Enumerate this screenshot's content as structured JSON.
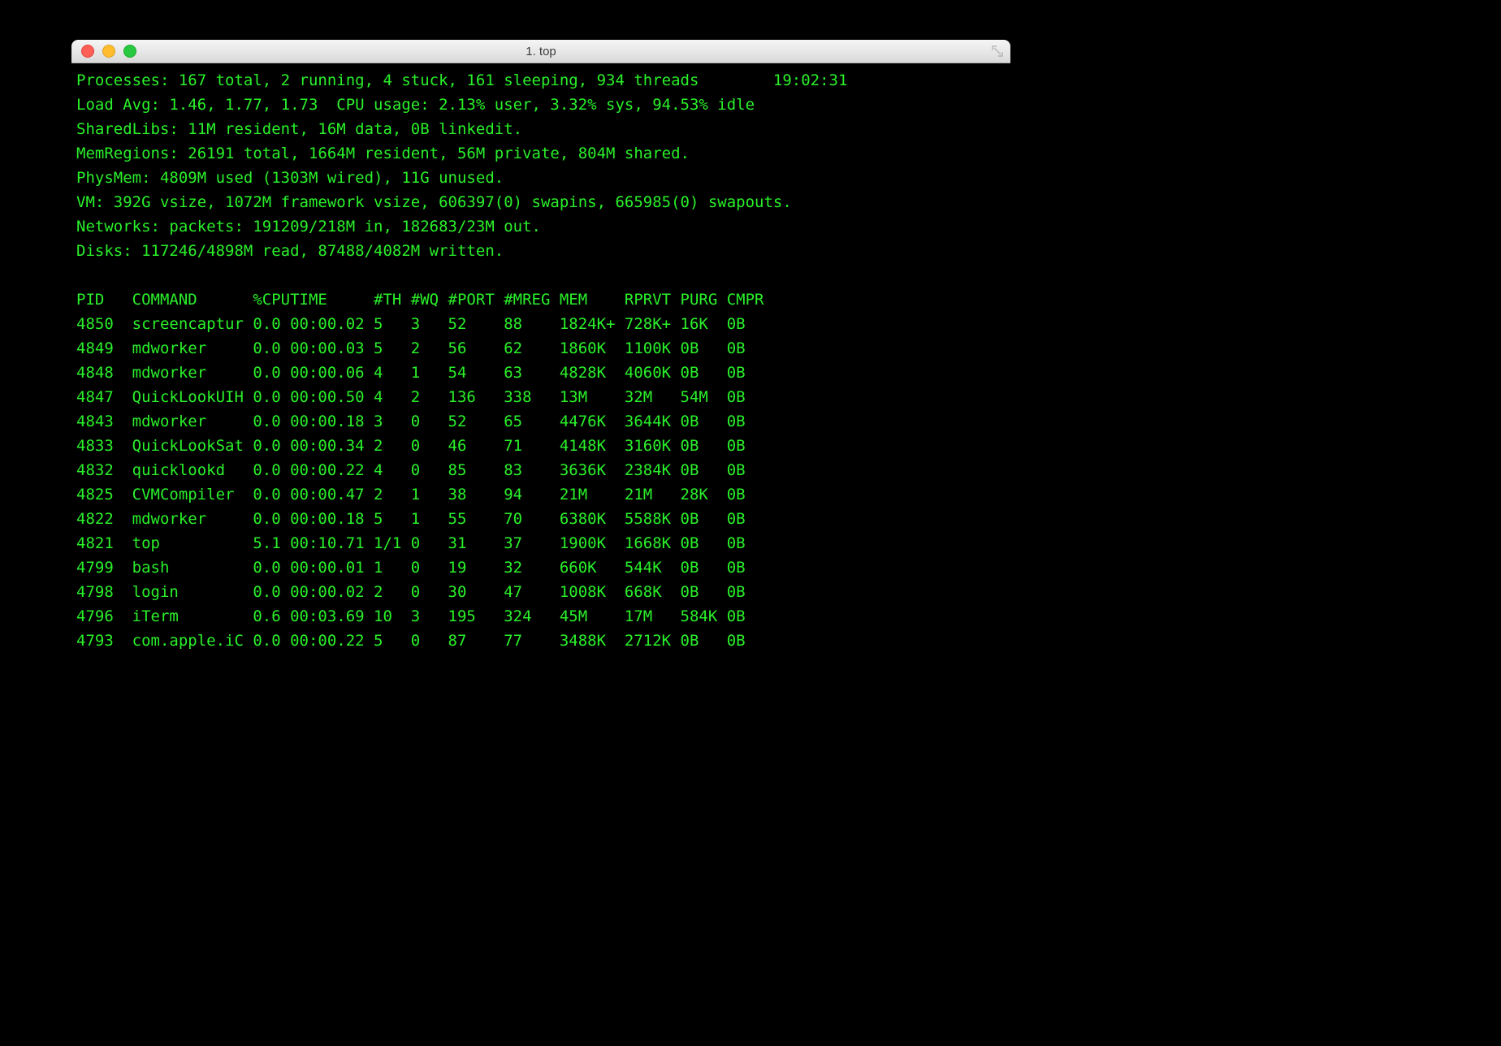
{
  "window": {
    "title": "1. top"
  },
  "summary": {
    "processes": "Processes: 167 total, 2 running, 4 stuck, 161 sleeping, 934 threads",
    "clock": "19:02:31",
    "load_cpu": "Load Avg: 1.46, 1.77, 1.73  CPU usage: 2.13% user, 3.32% sys, 94.53% idle",
    "sharedlibs": "SharedLibs: 11M resident, 16M data, 0B linkedit.",
    "memregions": "MemRegions: 26191 total, 1664M resident, 56M private, 804M shared.",
    "physmem": "PhysMem: 4809M used (1303M wired), 11G unused.",
    "vm": "VM: 392G vsize, 1072M framework vsize, 606397(0) swapins, 665985(0) swapouts.",
    "networks": "Networks: packets: 191209/218M in, 182683/23M out.",
    "disks": "Disks: 117246/4898M read, 87488/4082M written."
  },
  "columns": [
    "PID",
    "COMMAND",
    "%CPU",
    "TIME",
    "#TH",
    "#WQ",
    "#PORT",
    "#MREG",
    "MEM",
    "RPRVT",
    "PURG",
    "CMPR"
  ],
  "rows": [
    {
      "pid": "4850",
      "command": "screencaptur",
      "cpu": "0.0",
      "time": "00:00.02",
      "th": "5",
      "wq": "3",
      "port": "52",
      "mreg": "88",
      "mem": "1824K+",
      "rprvt": "728K+",
      "purg": "16K",
      "cmpr": "0B"
    },
    {
      "pid": "4849",
      "command": "mdworker",
      "cpu": "0.0",
      "time": "00:00.03",
      "th": "5",
      "wq": "2",
      "port": "56",
      "mreg": "62",
      "mem": "1860K",
      "rprvt": "1100K",
      "purg": "0B",
      "cmpr": "0B"
    },
    {
      "pid": "4848",
      "command": "mdworker",
      "cpu": "0.0",
      "time": "00:00.06",
      "th": "4",
      "wq": "1",
      "port": "54",
      "mreg": "63",
      "mem": "4828K",
      "rprvt": "4060K",
      "purg": "0B",
      "cmpr": "0B"
    },
    {
      "pid": "4847",
      "command": "QuickLookUIH",
      "cpu": "0.0",
      "time": "00:00.50",
      "th": "4",
      "wq": "2",
      "port": "136",
      "mreg": "338",
      "mem": "13M",
      "rprvt": "32M",
      "purg": "54M",
      "cmpr": "0B"
    },
    {
      "pid": "4843",
      "command": "mdworker",
      "cpu": "0.0",
      "time": "00:00.18",
      "th": "3",
      "wq": "0",
      "port": "52",
      "mreg": "65",
      "mem": "4476K",
      "rprvt": "3644K",
      "purg": "0B",
      "cmpr": "0B"
    },
    {
      "pid": "4833",
      "command": "QuickLookSat",
      "cpu": "0.0",
      "time": "00:00.34",
      "th": "2",
      "wq": "0",
      "port": "46",
      "mreg": "71",
      "mem": "4148K",
      "rprvt": "3160K",
      "purg": "0B",
      "cmpr": "0B"
    },
    {
      "pid": "4832",
      "command": "quicklookd",
      "cpu": "0.0",
      "time": "00:00.22",
      "th": "4",
      "wq": "0",
      "port": "85",
      "mreg": "83",
      "mem": "3636K",
      "rprvt": "2384K",
      "purg": "0B",
      "cmpr": "0B"
    },
    {
      "pid": "4825",
      "command": "CVMCompiler",
      "cpu": "0.0",
      "time": "00:00.47",
      "th": "2",
      "wq": "1",
      "port": "38",
      "mreg": "94",
      "mem": "21M",
      "rprvt": "21M",
      "purg": "28K",
      "cmpr": "0B"
    },
    {
      "pid": "4822",
      "command": "mdworker",
      "cpu": "0.0",
      "time": "00:00.18",
      "th": "5",
      "wq": "1",
      "port": "55",
      "mreg": "70",
      "mem": "6380K",
      "rprvt": "5588K",
      "purg": "0B",
      "cmpr": "0B"
    },
    {
      "pid": "4821",
      "command": "top",
      "cpu": "5.1",
      "time": "00:10.71",
      "th": "1/1",
      "wq": "0",
      "port": "31",
      "mreg": "37",
      "mem": "1900K",
      "rprvt": "1668K",
      "purg": "0B",
      "cmpr": "0B"
    },
    {
      "pid": "4799",
      "command": "bash",
      "cpu": "0.0",
      "time": "00:00.01",
      "th": "1",
      "wq": "0",
      "port": "19",
      "mreg": "32",
      "mem": "660K",
      "rprvt": "544K",
      "purg": "0B",
      "cmpr": "0B"
    },
    {
      "pid": "4798",
      "command": "login",
      "cpu": "0.0",
      "time": "00:00.02",
      "th": "2",
      "wq": "0",
      "port": "30",
      "mreg": "47",
      "mem": "1008K",
      "rprvt": "668K",
      "purg": "0B",
      "cmpr": "0B"
    },
    {
      "pid": "4796",
      "command": "iTerm",
      "cpu": "0.6",
      "time": "00:03.69",
      "th": "10",
      "wq": "3",
      "port": "195",
      "mreg": "324",
      "mem": "45M",
      "rprvt": "17M",
      "purg": "584K",
      "cmpr": "0B"
    },
    {
      "pid": "4793",
      "command": "com.apple.iC",
      "cpu": "0.0",
      "time": "00:00.22",
      "th": "5",
      "wq": "0",
      "port": "87",
      "mreg": "77",
      "mem": "3488K",
      "rprvt": "2712K",
      "purg": "0B",
      "cmpr": "0B"
    }
  ]
}
